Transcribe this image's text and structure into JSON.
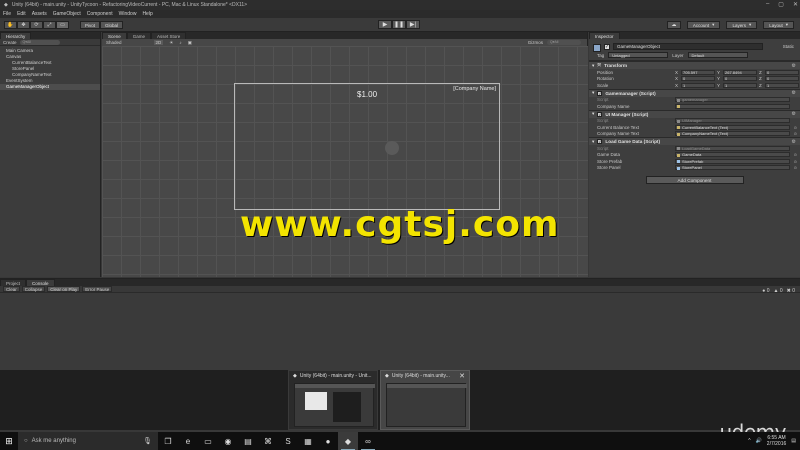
{
  "window": {
    "title": "Unity (64bit) - main.unity - UnityTycoon - RefactoringVideoCurrent - PC, Mac & Linux Standalone* <DX11>"
  },
  "menu": [
    "File",
    "Edit",
    "Assets",
    "GameObject",
    "Component",
    "Window",
    "Help"
  ],
  "toolbar": {
    "pivot_label": "Pivot",
    "global_label": "Global",
    "account_label": "Account",
    "layers_label": "Layers",
    "layout_label": "Layout"
  },
  "hierarchy": {
    "tab_label": "Hierarchy",
    "create_label": "Create",
    "search_placeholder": "Q▾All",
    "items": [
      {
        "label": "Main Camera",
        "depth": 1,
        "selected": false
      },
      {
        "label": "Canvas",
        "depth": 1,
        "selected": false
      },
      {
        "label": "CurrentBalanceText",
        "depth": 2,
        "selected": false
      },
      {
        "label": "StorePanel",
        "depth": 2,
        "selected": false
      },
      {
        "label": "CompanyNameText",
        "depth": 2,
        "selected": false
      },
      {
        "label": "EventSystem",
        "depth": 1,
        "selected": false
      },
      {
        "label": "GameManagerObject",
        "depth": 1,
        "selected": true
      }
    ]
  },
  "scene": {
    "tabs": [
      "Scene",
      "Game",
      "Asset Store"
    ],
    "shaded_label": "Shaded",
    "mode_2d": "2D",
    "gizmos_label": "Gizmos",
    "search_placeholder": "Q▾All",
    "balance_text": "$1.00",
    "company_text": "[Company Name]",
    "watermark": "www.cgtsj.com"
  },
  "inspector": {
    "tab_label": "Inspector",
    "object_name": "GameManagerObject",
    "static_label": "Static",
    "tag_label": "Tag",
    "tag_value": "Untagged",
    "layer_label": "Layer",
    "layer_value": "Default",
    "transform": {
      "title": "Transform",
      "position_label": "Position",
      "position": {
        "x": "705.597",
        "y": "267.8494",
        "z": "0"
      },
      "rotation_label": "Rotation",
      "rotation": {
        "x": "0",
        "y": "0",
        "z": "0"
      },
      "scale_label": "Scale",
      "scale": {
        "x": "1",
        "y": "1",
        "z": "1"
      }
    },
    "gamemanager": {
      "title": "Gamemanager (Script)",
      "script_label": "Script",
      "script_value": "gamemanager",
      "company_name_label": "Company Name",
      "company_name_value": ""
    },
    "uimanager": {
      "title": "UI Manager (Script)",
      "script_label": "Script",
      "script_value": "UIManager",
      "balance_label": "Current Balance Text",
      "balance_value": "CurrentBalanceText (Text)",
      "company_label": "Company Name Text",
      "company_value": "CompanyNameText (Text)"
    },
    "loadgame": {
      "title": "Load Game Data (Script)",
      "script_label": "Script",
      "script_value": "LoadGameData",
      "gamedata_label": "Game Data",
      "gamedata_value": "GameData",
      "storeprefab_label": "Store Prefab",
      "storeprefab_value": "StorePrefab",
      "storepanel_label": "Store Panel",
      "storepanel_value": "StorePanel"
    },
    "add_component_label": "Add Component"
  },
  "console": {
    "tabs": [
      "Project",
      "Console"
    ],
    "buttons": [
      "Clear",
      "Collapse",
      "Clear on Play",
      "Error Pause"
    ],
    "counts": [
      "0",
      "0",
      "0"
    ]
  },
  "task_thumbnails": [
    {
      "title": "Unity (64bit) - main.unity - Unit..."
    },
    {
      "title": "Unity (64bit) - main.unity..."
    }
  ],
  "branding": "udemy",
  "taskbar": {
    "search_placeholder": "Ask me anything",
    "time": "6:55 AM",
    "date": "2/7/2016"
  },
  "colors": {
    "watermark": "#f3e400",
    "editor_bg": "#383838",
    "taskbar_bg": "#0f0f0f"
  }
}
